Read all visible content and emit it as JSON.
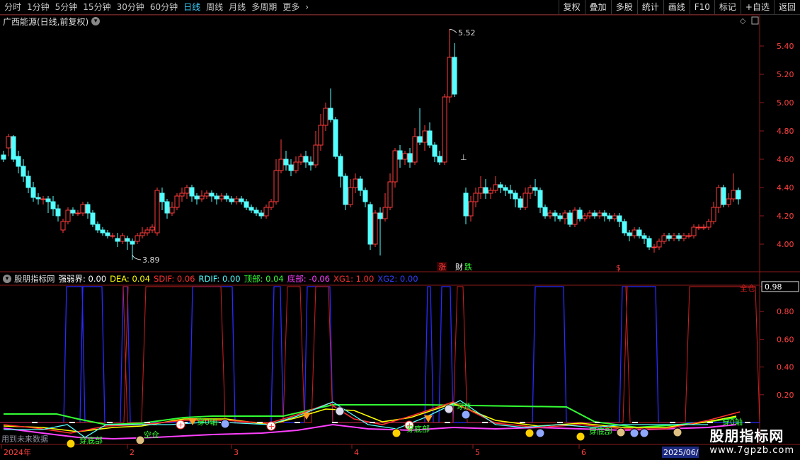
{
  "toolbar": {
    "periods": [
      "分时",
      "1分钟",
      "5分钟",
      "15分钟",
      "30分钟",
      "60分钟",
      "日线",
      "周线",
      "月线",
      "多周期",
      "更多"
    ],
    "active_period": "日线",
    "more_arrow": "›",
    "right_buttons": [
      "复权",
      "叠加",
      "多股",
      "统计",
      "画线",
      "F10",
      "标记",
      "+自选",
      "返回"
    ]
  },
  "main_panel": {
    "title": "广西能源(日线,前复权)",
    "high_label": "5.52",
    "low_label": "3.89",
    "price_ticks": [
      "5.40",
      "5.20",
      "5.00",
      "4.80",
      "4.60",
      "4.40",
      "4.20",
      "4.00"
    ],
    "events": [
      "涨",
      "财",
      "跌"
    ],
    "colors": {
      "up": "#ff3c3c",
      "down": "#54ffff",
      "bg": "#000000"
    }
  },
  "indicator_panel": {
    "name": "股朋指标网",
    "params": [
      {
        "label": "强弱界:",
        "value": "0.00",
        "color": "#ffffff"
      },
      {
        "label": "DEA:",
        "value": "0.04",
        "color": "#ffff00"
      },
      {
        "label": "SDIF:",
        "value": "0.06",
        "color": "#ff3030"
      },
      {
        "label": "RDIF:",
        "value": "0.00",
        "color": "#54ffff"
      },
      {
        "label": "顶部:",
        "value": "0.04",
        "color": "#33ff33"
      },
      {
        "label": "底部:",
        "value": "-0.06",
        "color": "#ff40ff"
      },
      {
        "label": "XG1:",
        "value": "1.00",
        "color": "#ff3030"
      },
      {
        "label": "XG2:",
        "value": "0.00",
        "color": "#3040ff"
      }
    ],
    "ticks": [
      "0.98",
      "0.80",
      "0.60",
      "0.40",
      "0.20"
    ],
    "highlight_tick": "0.98",
    "labels": {
      "full_win": "全仓",
      "bottom1": "穿底部",
      "bottom2": "穿底部",
      "bottom3": "穿底部",
      "top": "穿顶",
      "axis": "穿0轴",
      "axis2": "穿0轴",
      "empty": "空仓",
      "future": "用到未来数据"
    }
  },
  "time_axis": {
    "labels": [
      "2024年",
      "2",
      "3",
      "4",
      "5",
      "6"
    ],
    "current": "2025/06/"
  },
  "watermark": {
    "main": "股朋指标网",
    "url": "www.7gpzb.com"
  }
}
